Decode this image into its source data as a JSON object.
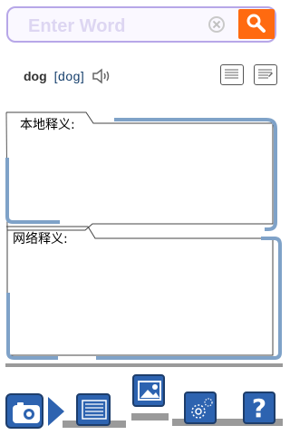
{
  "search": {
    "placeholder": "Enter Word"
  },
  "word": {
    "headword": "dog",
    "phonetic": "[dog]"
  },
  "panels": {
    "local_title": "本地释义:",
    "web_title": "网络释义:"
  },
  "toolbar": {
    "help_label": "?"
  },
  "colors": {
    "accent_orange": "#ff6a10",
    "panel_blue": "#7fa2c8",
    "button_blue": "#2d63b0",
    "search_border": "#b7a7e8"
  },
  "icons": {
    "search": "magnifier-icon",
    "clear": "clear-icon",
    "speaker": "speaker-icon",
    "tool1": "note-icon",
    "tool2": "edit-note-icon",
    "camera": "camera-icon",
    "arrow": "play-arrow-icon",
    "list": "list-icon",
    "image": "image-icon",
    "settings": "gear-icon",
    "help": "help-icon"
  }
}
